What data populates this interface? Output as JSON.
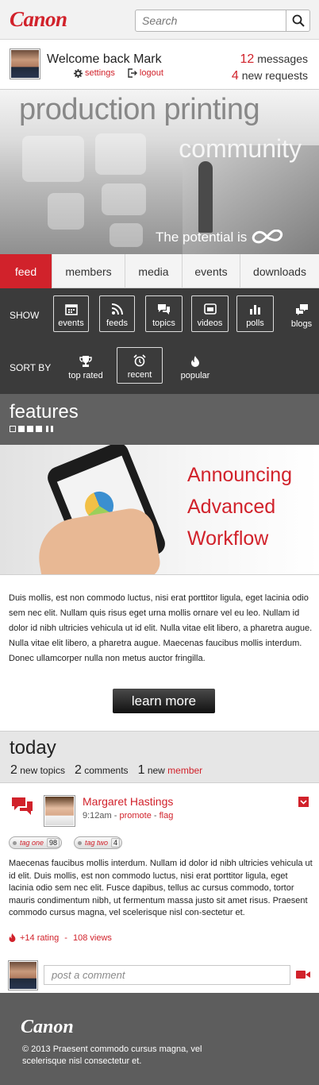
{
  "header": {
    "logo": "Canon",
    "search_placeholder": "Search"
  },
  "welcome": {
    "title": "Welcome back Mark",
    "settings": "settings",
    "logout": "logout",
    "messages_count": "12",
    "messages_label": "messages",
    "requests_count": "4",
    "requests_label": "new requests"
  },
  "hero": {
    "title_line1": "production printing",
    "title_line2": "community",
    "tagline": "The potential is"
  },
  "tabs": [
    {
      "label": "feed",
      "active": true
    },
    {
      "label": "members",
      "active": false
    },
    {
      "label": "media",
      "active": false
    },
    {
      "label": "events",
      "active": false
    },
    {
      "label": "downloads",
      "active": false
    }
  ],
  "filters": {
    "show_label": "SHOW",
    "sort_label": "SORT BY",
    "show": [
      {
        "label": "events",
        "icon": "calendar-icon",
        "selected": true
      },
      {
        "label": "feeds",
        "icon": "rss-icon",
        "selected": true
      },
      {
        "label": "topics",
        "icon": "chat-bubbles-icon",
        "selected": true
      },
      {
        "label": "videos",
        "icon": "video-icon",
        "selected": true
      },
      {
        "label": "polls",
        "icon": "bar-chart-icon",
        "selected": true
      },
      {
        "label": "blogs",
        "icon": "blog-icon",
        "selected": false
      }
    ],
    "sort": [
      {
        "label": "top rated",
        "icon": "trophy-icon",
        "selected": false
      },
      {
        "label": "recent",
        "icon": "alarm-clock-icon",
        "selected": true
      },
      {
        "label": "popular",
        "icon": "flame-icon",
        "selected": false
      }
    ]
  },
  "features": {
    "heading": "features",
    "headline_line1": "Announcing",
    "headline_line2": "Advanced",
    "headline_line3": "Workflow",
    "body": "Duis mollis, est non commodo luctus, nisi erat porttitor ligula, eget lacinia odio sem nec elit. Nullam quis risus eget urna mollis ornare vel eu leo. Nullam id dolor id nibh ultricies vehicula ut id elit. Nulla vitae elit libero, a pharetra augue. Nulla vitae elit libero, a pharetra augue. Maecenas faucibus mollis interdum. Donec ullamcorper nulla non metus auctor fringilla.",
    "button": "learn more"
  },
  "today": {
    "heading": "today",
    "topics_count": "2",
    "topics_label": "new topics",
    "comments_count": "2",
    "comments_label": "comments",
    "members_count": "1",
    "members_label_prefix": "new",
    "members_label": "member"
  },
  "post": {
    "author": "Margaret Hastings",
    "time": "9:12am",
    "promote": "promote",
    "flag": "flag",
    "tags": [
      {
        "name": "tag one",
        "count": "98"
      },
      {
        "name": "tag two",
        "count": "4"
      }
    ],
    "body": "Maecenas faucibus mollis interdum. Nullam id dolor id nibh ultricies vehicula ut id elit. Duis mollis, est non commodo luctus, nisi erat porttitor ligula, eget lacinia odio sem nec elit. Fusce dapibus, tellus ac cursus commodo, tortor mauris condimentum nibh, ut fermentum massa justo sit amet risus. Praesent commodo cursus magna, vel scelerisque nisl con-sectetur et.",
    "rating": "+14 rating",
    "views": "108 views"
  },
  "comment": {
    "placeholder": "post a comment"
  },
  "footer": {
    "logo": "Canon",
    "copyright": "© 2013 Praesent commodo cursus magna, vel scelerisque nisl consectetur et."
  },
  "colors": {
    "brand_red": "#d1222b",
    "dark_panel": "#3b3b3b",
    "section_gray": "#616161"
  }
}
